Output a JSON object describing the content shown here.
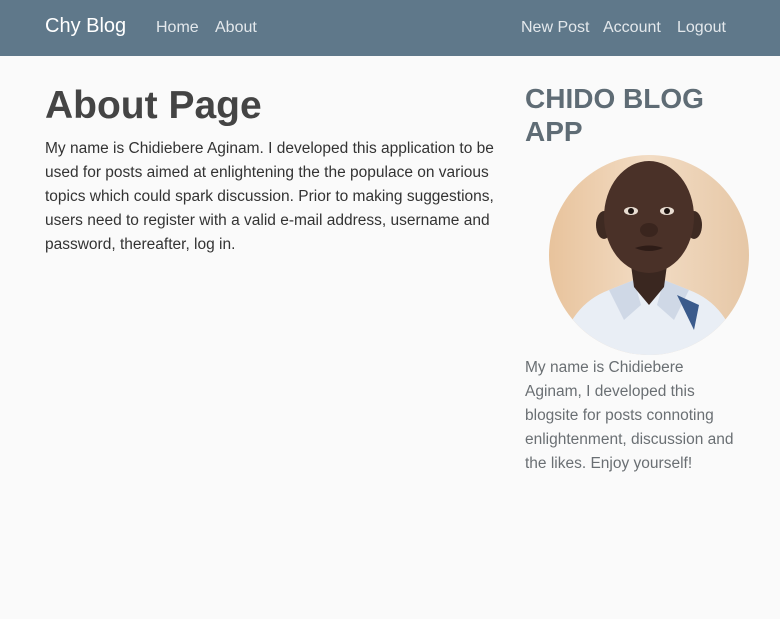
{
  "navbar": {
    "brand": "Chy Blog",
    "links": {
      "home": "Home",
      "about": "About",
      "new_post": "New Post",
      "account": "Account",
      "logout": "Logout"
    },
    "background": "#5f788a"
  },
  "main": {
    "title": "About Page",
    "text": "My name is Chidiebere Aginam. I developed this application to be used for posts aimed at enlightening the the populace on various topics which could spark discussion. Prior to making suggestions, users need to register with a valid e-mail address, username and password, thereafter, log in."
  },
  "sidebar": {
    "title": "CHIDO BLOG APP",
    "avatar_icon": "profile-photo",
    "text": "My name is Chidiebere Aginam, I developed this blogsite for posts connoting enlightenment, discussion and the likes. Enjoy yourself!"
  }
}
